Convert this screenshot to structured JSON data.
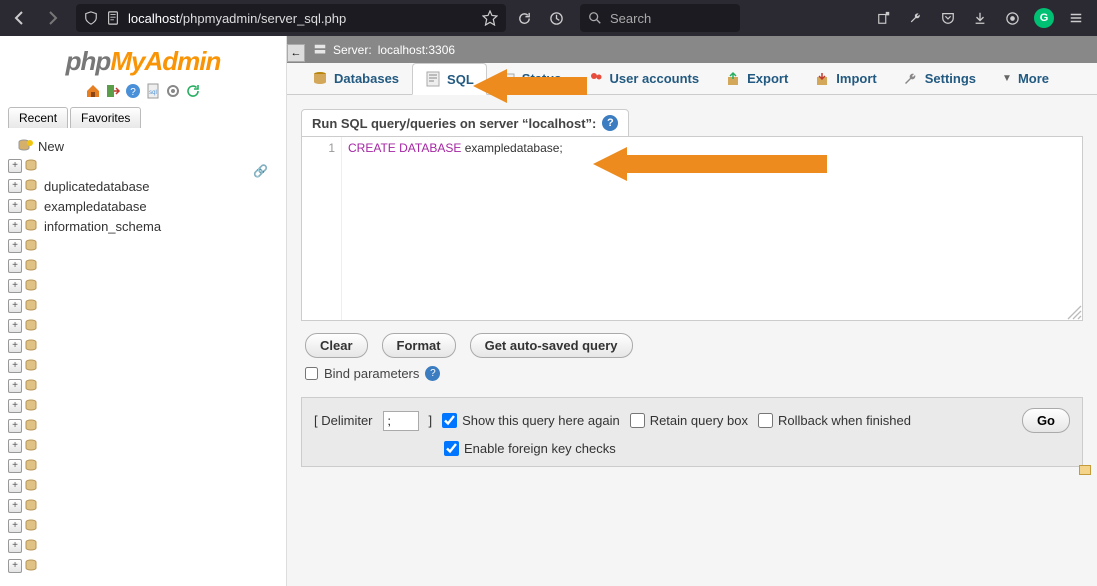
{
  "browser": {
    "url_host": "localhost",
    "url_path": "/phpmyadmin/server_sql.php",
    "search_placeholder": "Search"
  },
  "logo": {
    "part1": "php",
    "part2": "MyAdmin"
  },
  "side_tabs": {
    "recent": "Recent",
    "favorites": "Favorites"
  },
  "tree": {
    "new": "New",
    "items": [
      {
        "label": ""
      },
      {
        "label": "duplicatedatabase"
      },
      {
        "label": "exampledatabase"
      },
      {
        "label": "information_schema"
      },
      {
        "label": ""
      },
      {
        "label": ""
      },
      {
        "label": ""
      },
      {
        "label": ""
      },
      {
        "label": ""
      },
      {
        "label": ""
      },
      {
        "label": ""
      },
      {
        "label": ""
      },
      {
        "label": ""
      },
      {
        "label": ""
      },
      {
        "label": ""
      },
      {
        "label": ""
      },
      {
        "label": ""
      },
      {
        "label": ""
      },
      {
        "label": ""
      },
      {
        "label": ""
      },
      {
        "label": ""
      }
    ]
  },
  "breadcrumb": {
    "server_label": "Server:",
    "server_value": "localhost:3306"
  },
  "tabs": {
    "databases": "Databases",
    "sql": "SQL",
    "status": "Status",
    "accounts": "User accounts",
    "export": "Export",
    "import": "Import",
    "settings": "Settings",
    "more": "More"
  },
  "query": {
    "title": "Run SQL query/queries on server “localhost”:",
    "line_no": "1",
    "keyword": "CREATE DATABASE",
    "rest": " exampledatabase;"
  },
  "buttons": {
    "clear": "Clear",
    "format": "Format",
    "auto": "Get auto-saved query",
    "go": "Go"
  },
  "options": {
    "bind": "Bind parameters",
    "delimiter_label_open": "[ Delimiter",
    "delimiter_value": ";",
    "delimiter_label_close": "]",
    "show_again": "Show this query here again",
    "retain": "Retain query box",
    "rollback": "Rollback when finished",
    "fk": "Enable foreign key checks"
  }
}
